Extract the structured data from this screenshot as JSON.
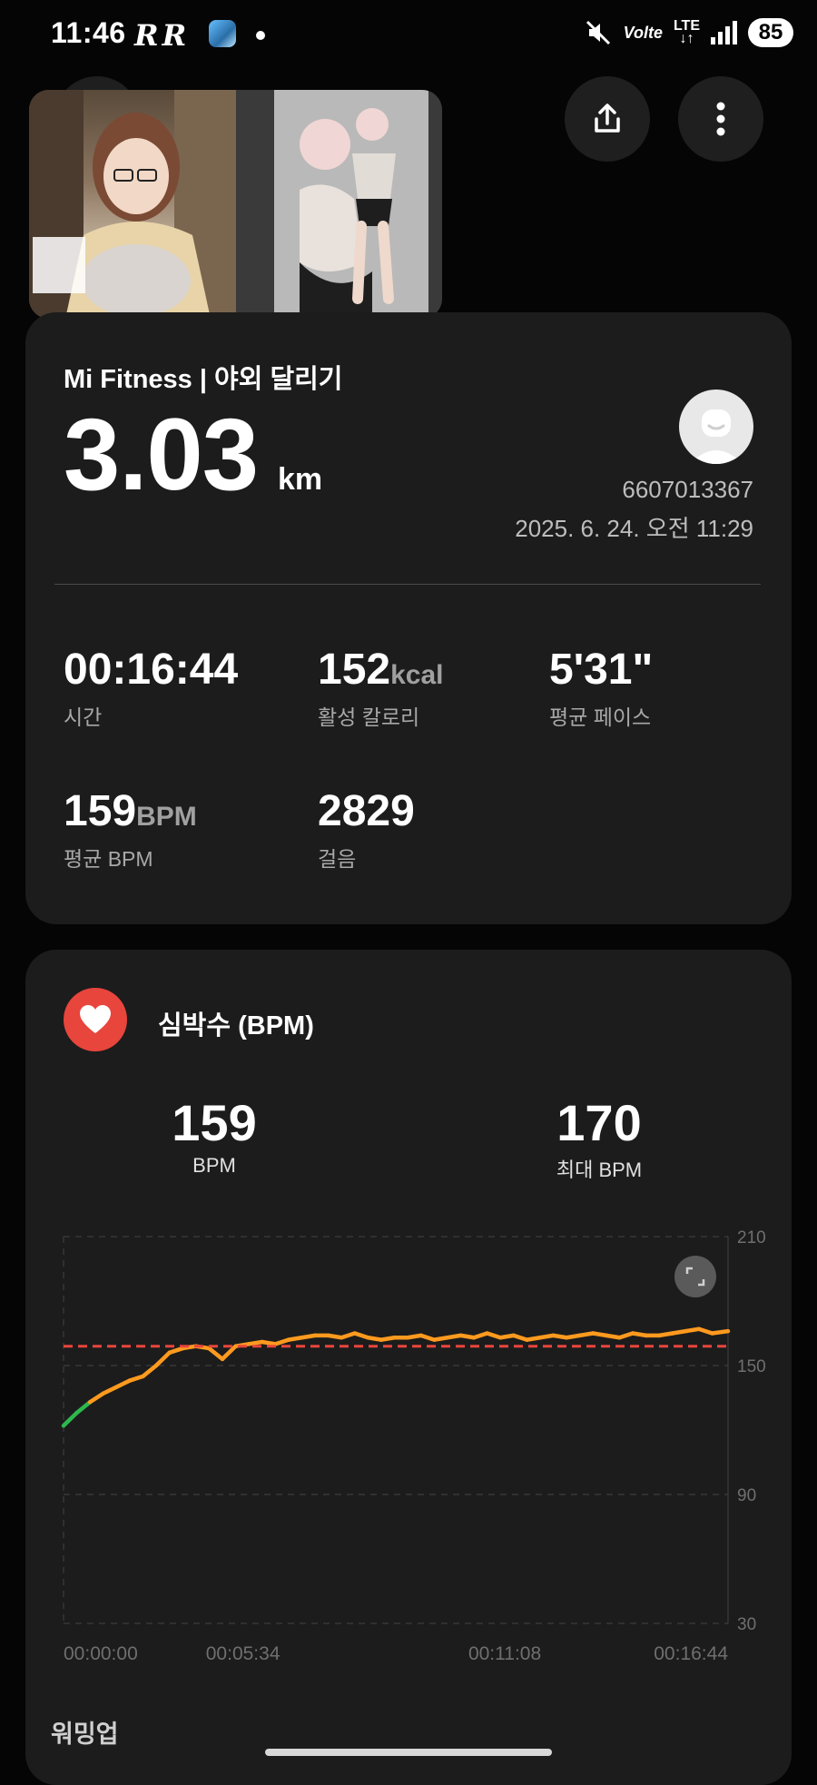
{
  "status_bar": {
    "time": "11:46",
    "notif_glyphs": [
      "R",
      "R"
    ],
    "battery": "85",
    "network": "LTE",
    "volte": "Volte"
  },
  "header": {
    "title": "야외 달리기",
    "title_visible": "리기"
  },
  "summary": {
    "title": "Mi Fitness | 야외 달리기",
    "distance": "3.03",
    "distance_unit": "km",
    "user_id": "6607013367",
    "datetime": "2025. 6. 24. 오전 11:29",
    "stats": [
      {
        "value": "00:16:44",
        "unit": "",
        "label": "시간"
      },
      {
        "value": "152",
        "unit": "kcal",
        "label": "활성 칼로리"
      },
      {
        "value": "5'31\"",
        "unit": "",
        "label": "평균 페이스"
      },
      {
        "value": "159",
        "unit": "BPM",
        "label": "평균 BPM"
      },
      {
        "value": "2829",
        "unit": "",
        "label": "걸음"
      }
    ]
  },
  "heart_rate": {
    "title": "심박수 (BPM)",
    "avg_value": "159",
    "avg_label": "BPM",
    "max_value": "170",
    "max_label": "최대 BPM",
    "colors": {
      "zone_low": "#2db84d",
      "zone_high": "#ff9a1f",
      "avg_line": "#e8453c"
    }
  },
  "chart_data": {
    "type": "line",
    "title": "심박수 (BPM)",
    "y_ticks": [
      "210",
      "150",
      "90",
      "30"
    ],
    "x_ticks": [
      "00:00:00",
      "00:05:34",
      "00:11:08",
      "00:16:44"
    ],
    "ylim": [
      30,
      210
    ],
    "xlim_seconds": [
      0,
      1004
    ],
    "average_line": 159,
    "grid": true,
    "series": [
      {
        "x": [
          0,
          20,
          40,
          60,
          80,
          100,
          120,
          140,
          160,
          180,
          200,
          220,
          240,
          260,
          280,
          300,
          320,
          340,
          360,
          380,
          400,
          420,
          440,
          460,
          480,
          500,
          520,
          540,
          560,
          580,
          600,
          620,
          640,
          660,
          680,
          700,
          720,
          740,
          760,
          780,
          800,
          820,
          840,
          860,
          880,
          900,
          920,
          940,
          960,
          980,
          1004
        ],
        "y": [
          122,
          128,
          133,
          137,
          140,
          143,
          145,
          150,
          156,
          158,
          159,
          158,
          153,
          159,
          160,
          161,
          160,
          162,
          163,
          164,
          164,
          163,
          165,
          163,
          162,
          163,
          163,
          164,
          162,
          163,
          164,
          163,
          165,
          163,
          164,
          162,
          163,
          164,
          163,
          164,
          165,
          164,
          163,
          165,
          164,
          164,
          165,
          166,
          167,
          165,
          166
        ]
      }
    ]
  },
  "bottom": {
    "text": "워밍업"
  }
}
